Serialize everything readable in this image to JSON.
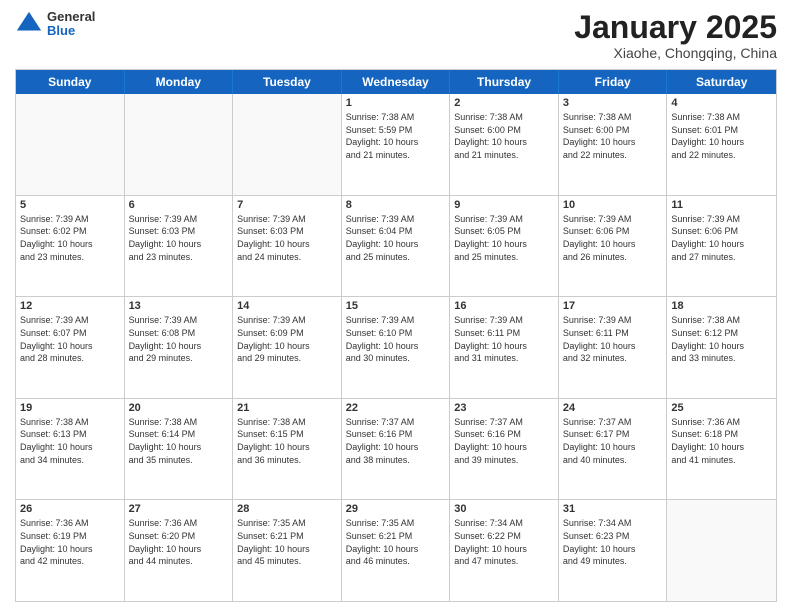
{
  "logo": {
    "general": "General",
    "blue": "Blue"
  },
  "header": {
    "month": "January 2025",
    "location": "Xiaohe, Chongqing, China"
  },
  "days_of_week": [
    "Sunday",
    "Monday",
    "Tuesday",
    "Wednesday",
    "Thursday",
    "Friday",
    "Saturday"
  ],
  "weeks": [
    [
      {
        "day": "",
        "empty": true
      },
      {
        "day": "",
        "empty": true
      },
      {
        "day": "",
        "empty": true
      },
      {
        "day": "1",
        "info": "Sunrise: 7:38 AM\nSunset: 5:59 PM\nDaylight: 10 hours\nand 21 minutes."
      },
      {
        "day": "2",
        "info": "Sunrise: 7:38 AM\nSunset: 6:00 PM\nDaylight: 10 hours\nand 21 minutes."
      },
      {
        "day": "3",
        "info": "Sunrise: 7:38 AM\nSunset: 6:00 PM\nDaylight: 10 hours\nand 22 minutes."
      },
      {
        "day": "4",
        "info": "Sunrise: 7:38 AM\nSunset: 6:01 PM\nDaylight: 10 hours\nand 22 minutes."
      }
    ],
    [
      {
        "day": "5",
        "info": "Sunrise: 7:39 AM\nSunset: 6:02 PM\nDaylight: 10 hours\nand 23 minutes."
      },
      {
        "day": "6",
        "info": "Sunrise: 7:39 AM\nSunset: 6:03 PM\nDaylight: 10 hours\nand 23 minutes."
      },
      {
        "day": "7",
        "info": "Sunrise: 7:39 AM\nSunset: 6:03 PM\nDaylight: 10 hours\nand 24 minutes."
      },
      {
        "day": "8",
        "info": "Sunrise: 7:39 AM\nSunset: 6:04 PM\nDaylight: 10 hours\nand 25 minutes."
      },
      {
        "day": "9",
        "info": "Sunrise: 7:39 AM\nSunset: 6:05 PM\nDaylight: 10 hours\nand 25 minutes."
      },
      {
        "day": "10",
        "info": "Sunrise: 7:39 AM\nSunset: 6:06 PM\nDaylight: 10 hours\nand 26 minutes."
      },
      {
        "day": "11",
        "info": "Sunrise: 7:39 AM\nSunset: 6:06 PM\nDaylight: 10 hours\nand 27 minutes."
      }
    ],
    [
      {
        "day": "12",
        "info": "Sunrise: 7:39 AM\nSunset: 6:07 PM\nDaylight: 10 hours\nand 28 minutes."
      },
      {
        "day": "13",
        "info": "Sunrise: 7:39 AM\nSunset: 6:08 PM\nDaylight: 10 hours\nand 29 minutes."
      },
      {
        "day": "14",
        "info": "Sunrise: 7:39 AM\nSunset: 6:09 PM\nDaylight: 10 hours\nand 29 minutes."
      },
      {
        "day": "15",
        "info": "Sunrise: 7:39 AM\nSunset: 6:10 PM\nDaylight: 10 hours\nand 30 minutes."
      },
      {
        "day": "16",
        "info": "Sunrise: 7:39 AM\nSunset: 6:11 PM\nDaylight: 10 hours\nand 31 minutes."
      },
      {
        "day": "17",
        "info": "Sunrise: 7:39 AM\nSunset: 6:11 PM\nDaylight: 10 hours\nand 32 minutes."
      },
      {
        "day": "18",
        "info": "Sunrise: 7:38 AM\nSunset: 6:12 PM\nDaylight: 10 hours\nand 33 minutes."
      }
    ],
    [
      {
        "day": "19",
        "info": "Sunrise: 7:38 AM\nSunset: 6:13 PM\nDaylight: 10 hours\nand 34 minutes."
      },
      {
        "day": "20",
        "info": "Sunrise: 7:38 AM\nSunset: 6:14 PM\nDaylight: 10 hours\nand 35 minutes."
      },
      {
        "day": "21",
        "info": "Sunrise: 7:38 AM\nSunset: 6:15 PM\nDaylight: 10 hours\nand 36 minutes."
      },
      {
        "day": "22",
        "info": "Sunrise: 7:37 AM\nSunset: 6:16 PM\nDaylight: 10 hours\nand 38 minutes."
      },
      {
        "day": "23",
        "info": "Sunrise: 7:37 AM\nSunset: 6:16 PM\nDaylight: 10 hours\nand 39 minutes."
      },
      {
        "day": "24",
        "info": "Sunrise: 7:37 AM\nSunset: 6:17 PM\nDaylight: 10 hours\nand 40 minutes."
      },
      {
        "day": "25",
        "info": "Sunrise: 7:36 AM\nSunset: 6:18 PM\nDaylight: 10 hours\nand 41 minutes."
      }
    ],
    [
      {
        "day": "26",
        "info": "Sunrise: 7:36 AM\nSunset: 6:19 PM\nDaylight: 10 hours\nand 42 minutes."
      },
      {
        "day": "27",
        "info": "Sunrise: 7:36 AM\nSunset: 6:20 PM\nDaylight: 10 hours\nand 44 minutes."
      },
      {
        "day": "28",
        "info": "Sunrise: 7:35 AM\nSunset: 6:21 PM\nDaylight: 10 hours\nand 45 minutes."
      },
      {
        "day": "29",
        "info": "Sunrise: 7:35 AM\nSunset: 6:21 PM\nDaylight: 10 hours\nand 46 minutes."
      },
      {
        "day": "30",
        "info": "Sunrise: 7:34 AM\nSunset: 6:22 PM\nDaylight: 10 hours\nand 47 minutes."
      },
      {
        "day": "31",
        "info": "Sunrise: 7:34 AM\nSunset: 6:23 PM\nDaylight: 10 hours\nand 49 minutes."
      },
      {
        "day": "",
        "empty": true
      }
    ]
  ]
}
